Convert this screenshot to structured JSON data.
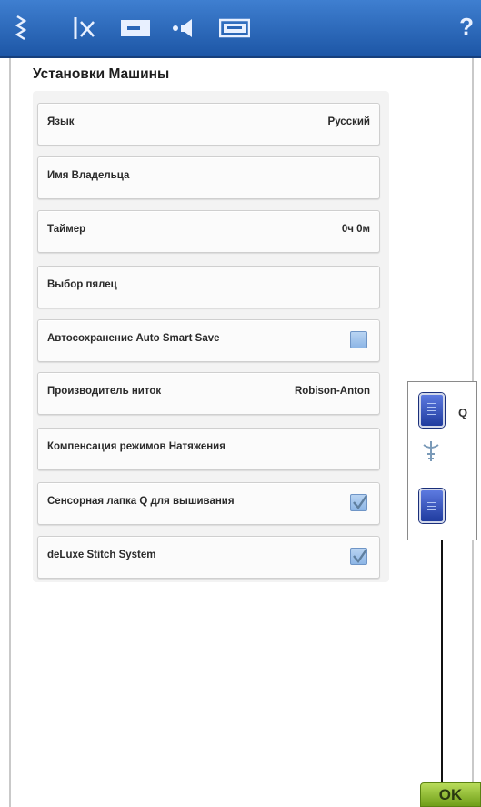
{
  "toolbar": {
    "icons": [
      "stitch-menu-icon",
      "text-edit-icon",
      "machine-settings-icon",
      "sound-settings-icon",
      "machine-info-icon",
      "help-icon"
    ],
    "help_label": "?"
  },
  "page_title": "Установки Машины",
  "settings": [
    {
      "label": "Язык",
      "value": "Русский"
    },
    {
      "label": "Имя Владельца",
      "value": ""
    },
    {
      "label": "Таймер",
      "value": "0ч 0м"
    },
    {
      "label": "Выбор пялец",
      "value": ""
    },
    {
      "label": "Автосохранение Auto Smart Save",
      "checkbox": true,
      "checked": false
    },
    {
      "label": "Производитель ниток",
      "value": "Robison-Anton"
    },
    {
      "label": "Компенсация режимов Натяжения",
      "value": ""
    },
    {
      "label": "Сенсорная лапка Q для вышивания",
      "checkbox": true,
      "checked": true
    },
    {
      "label": "deLuxe Stitch System",
      "checkbox": true,
      "checked": true
    }
  ],
  "side_panel": {
    "q_label": "Q"
  },
  "ok_label": "OK",
  "colors": {
    "toolbar": "#2a66b8",
    "ok_button": "#8fbf2a",
    "checkbox": "#a9c8ee"
  }
}
